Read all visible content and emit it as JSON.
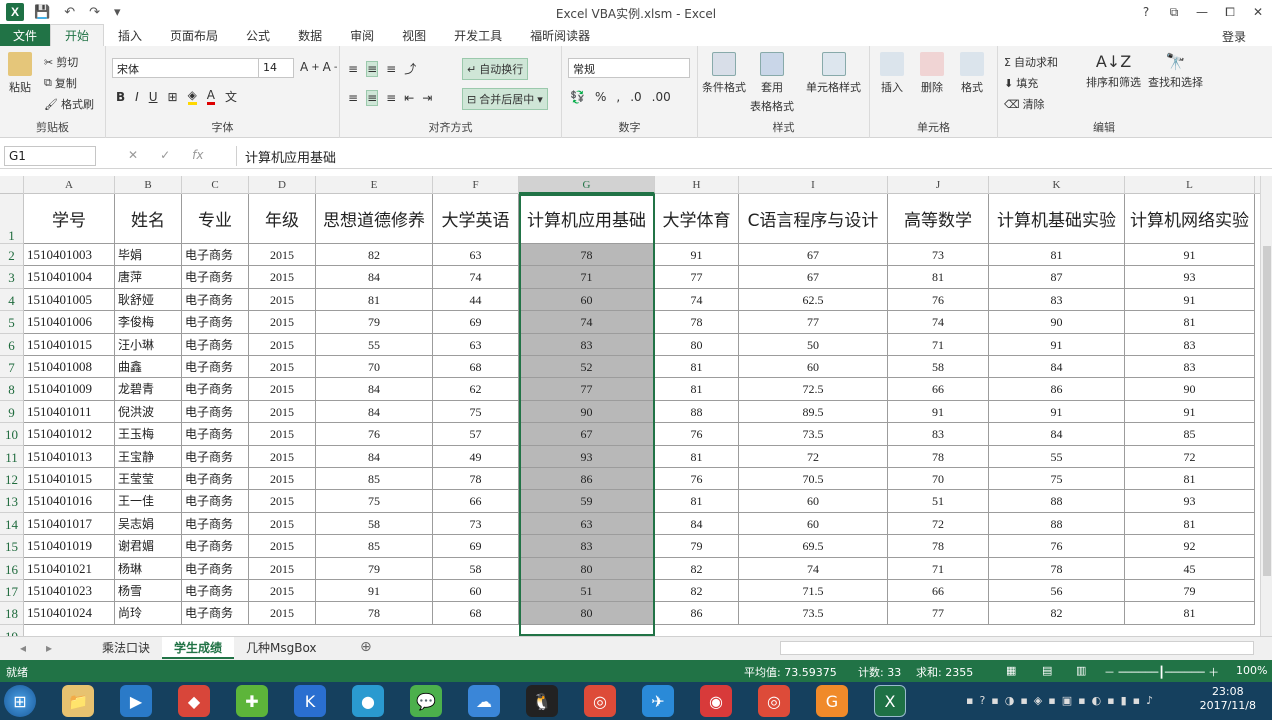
{
  "title": "Excel VBA实例.xlsm - Excel",
  "quick_access": [
    "save-icon",
    "undo-icon",
    "redo-icon"
  ],
  "window_controls": [
    "?",
    "⧉",
    "—",
    "⧠",
    "✕"
  ],
  "tabs": [
    "文件",
    "开始",
    "插入",
    "页面布局",
    "公式",
    "数据",
    "审阅",
    "视图",
    "开发工具",
    "福昕阅读器"
  ],
  "login": "登录",
  "ribbon": {
    "clipboard": {
      "paste": "粘贴",
      "cut": "剪切",
      "copy": "复制",
      "format": "格式刷",
      "label": "剪贴板"
    },
    "font": {
      "name": "宋体",
      "size": "14",
      "label": "字体"
    },
    "align": {
      "wrap": "自动换行",
      "merge": "合并后居中",
      "label": "对齐方式"
    },
    "number": {
      "format": "常规",
      "label": "数字"
    },
    "styles": {
      "cond": "条件格式",
      "table": "套用",
      "table2": "表格格式",
      "cell": "单元格样式",
      "label": "样式"
    },
    "cells": {
      "insert": "插入",
      "delete": "删除",
      "format": "格式",
      "label": "单元格"
    },
    "edit": {
      "autosum": "自动求和",
      "fill": "填充",
      "clear": "清除",
      "sort": "排序和筛选",
      "find": "查找和选择",
      "label": "编辑"
    }
  },
  "namebox": "G1",
  "formula": "计算机应用基础",
  "columns": [
    "A",
    "B",
    "C",
    "D",
    "E",
    "F",
    "G",
    "H",
    "I",
    "J",
    "K",
    "L"
  ],
  "headers": [
    "学号",
    "姓名",
    "专业",
    "年级",
    "思想道德修养",
    "大学英语",
    "计算机应用基础",
    "大学体育",
    "C语言程序与设计",
    "高等数学",
    "计算机基础实验",
    "计算机网络实验"
  ],
  "rows": [
    [
      "1510401003",
      "毕娟",
      "电子商务",
      "2015",
      "82",
      "63",
      "78",
      "91",
      "67",
      "73",
      "81",
      "91"
    ],
    [
      "1510401004",
      "唐萍",
      "电子商务",
      "2015",
      "84",
      "74",
      "71",
      "77",
      "67",
      "81",
      "87",
      "93"
    ],
    [
      "1510401005",
      "耿舒娅",
      "电子商务",
      "2015",
      "81",
      "44",
      "60",
      "74",
      "62.5",
      "76",
      "83",
      "91"
    ],
    [
      "1510401006",
      "李俊梅",
      "电子商务",
      "2015",
      "79",
      "69",
      "74",
      "78",
      "77",
      "74",
      "90",
      "81"
    ],
    [
      "1510401015",
      "汪小琳",
      "电子商务",
      "2015",
      "55",
      "63",
      "83",
      "80",
      "50",
      "71",
      "91",
      "83"
    ],
    [
      "1510401008",
      "曲鑫",
      "电子商务",
      "2015",
      "70",
      "68",
      "52",
      "81",
      "60",
      "58",
      "84",
      "83"
    ],
    [
      "1510401009",
      "龙碧青",
      "电子商务",
      "2015",
      "84",
      "62",
      "77",
      "81",
      "72.5",
      "66",
      "86",
      "90"
    ],
    [
      "1510401011",
      "倪洪波",
      "电子商务",
      "2015",
      "84",
      "75",
      "90",
      "88",
      "89.5",
      "91",
      "91",
      "91"
    ],
    [
      "1510401012",
      "王玉梅",
      "电子商务",
      "2015",
      "76",
      "57",
      "67",
      "76",
      "73.5",
      "83",
      "84",
      "85"
    ],
    [
      "1510401013",
      "王宝静",
      "电子商务",
      "2015",
      "84",
      "49",
      "93",
      "81",
      "72",
      "78",
      "55",
      "72"
    ],
    [
      "1510401015",
      "王莹莹",
      "电子商务",
      "2015",
      "85",
      "78",
      "86",
      "76",
      "70.5",
      "70",
      "75",
      "81"
    ],
    [
      "1510401016",
      "王一佳",
      "电子商务",
      "2015",
      "75",
      "66",
      "59",
      "81",
      "60",
      "51",
      "88",
      "93"
    ],
    [
      "1510401017",
      "吴志娟",
      "电子商务",
      "2015",
      "58",
      "73",
      "63",
      "84",
      "60",
      "72",
      "88",
      "81"
    ],
    [
      "1510401019",
      "谢君媚",
      "电子商务",
      "2015",
      "85",
      "69",
      "83",
      "79",
      "69.5",
      "78",
      "76",
      "92"
    ],
    [
      "1510401021",
      "杨琳",
      "电子商务",
      "2015",
      "79",
      "58",
      "80",
      "82",
      "74",
      "71",
      "78",
      "45"
    ],
    [
      "1510401023",
      "杨雪",
      "电子商务",
      "2015",
      "91",
      "60",
      "51",
      "82",
      "71.5",
      "66",
      "56",
      "79"
    ],
    [
      "1510401024",
      "尚玲",
      "电子商务",
      "2015",
      "78",
      "68",
      "80",
      "86",
      "73.5",
      "77",
      "82",
      "81"
    ]
  ],
  "sheets": [
    "乘法口诀",
    "学生成绩",
    "几种MsgBox"
  ],
  "status": {
    "ready": "就绪",
    "avg": "平均值: 73.59375",
    "count": "计数: 33",
    "sum": "求和: 2355",
    "zoom": "100%"
  },
  "clock": {
    "time": "23:08",
    "date": "2017/11/8"
  },
  "colors": {
    "accent": "#217346",
    "selection": "#b8b8b8",
    "taskbar": "#15405e"
  }
}
